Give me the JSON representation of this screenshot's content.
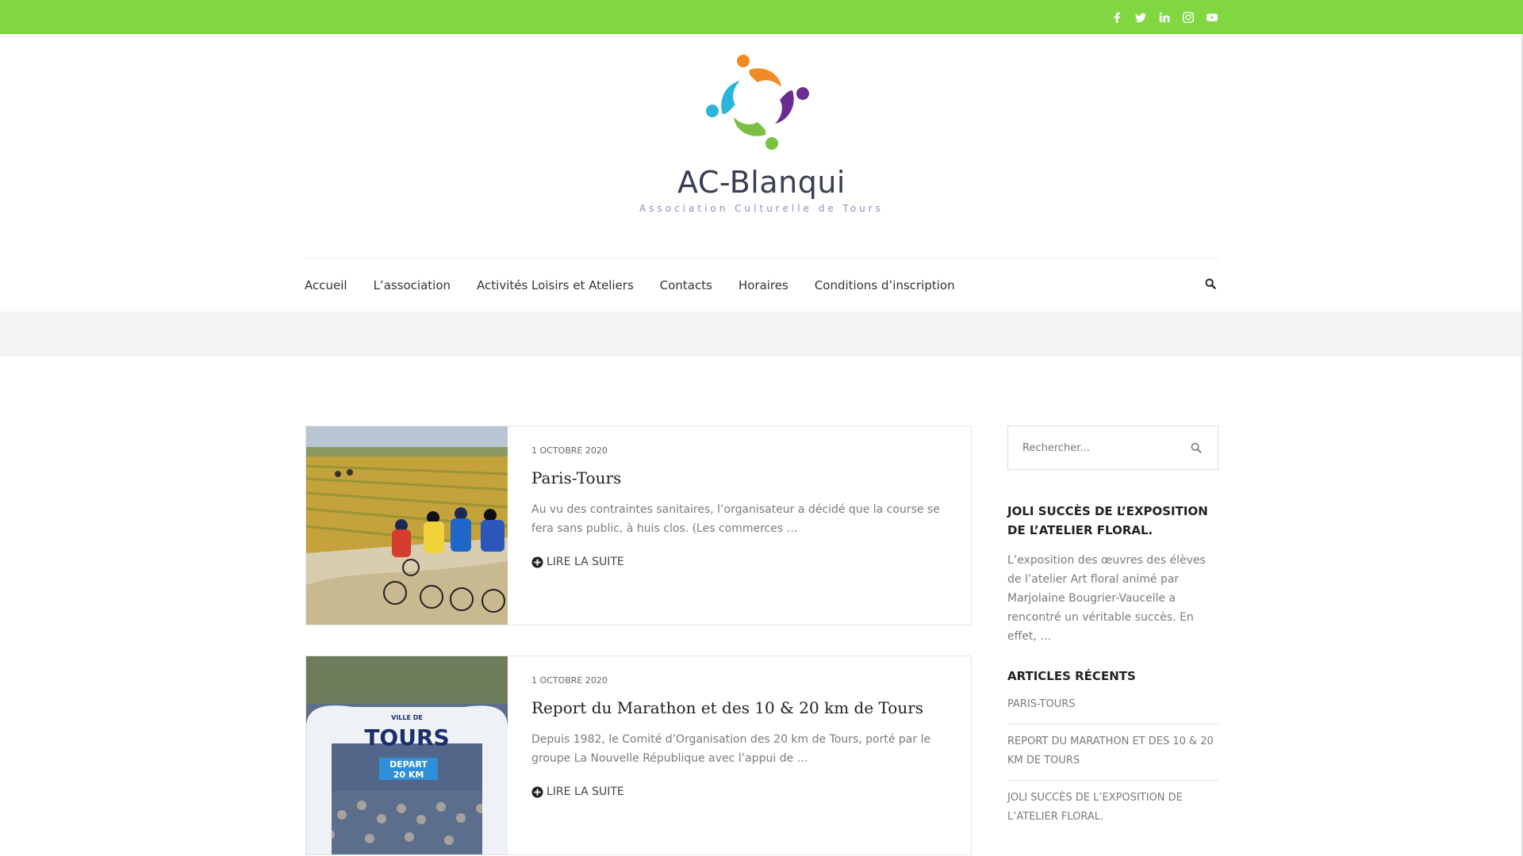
{
  "topbar": {
    "color": "#81d742",
    "social": [
      "facebook-icon",
      "twitter-icon",
      "linkedin-icon",
      "instagram-icon",
      "youtube-icon"
    ]
  },
  "site": {
    "title": "AC-Blanqui",
    "tagline": "Association Culturelle de Tours"
  },
  "nav": {
    "items": [
      "Accueil",
      "L’association",
      "Activités Loisirs et Ateliers",
      "Contacts",
      "Horaires",
      "Conditions d’inscription"
    ]
  },
  "posts": [
    {
      "date": "1 octobre 2020",
      "title": "Paris-Tours",
      "excerpt": "Au vu des contraintes sanitaires, l’organisateur a décidé que la course se fera sans public, à huis clos. (Les commerces …",
      "more": "Lire la suite",
      "image": "cyclists-in-vineyard"
    },
    {
      "date": "1 octobre 2020",
      "title": "Report du Marathon et des 10 & 20 km de Tours",
      "excerpt": "Depuis 1982, le Comité d’Organisation des 20 km de Tours, porté par le groupe La Nouvelle République avec l’appui de …",
      "more": "Lire la suite",
      "image": "marathon-start-arch",
      "arch_top": "VILLE DE",
      "arch_main": "TOURS",
      "arch_sub1": "DEPART",
      "arch_sub2": "20 KM"
    }
  ],
  "sidebar": {
    "search_placeholder": "Rechercher...",
    "widget1": {
      "title": "Joli succès de l’exposition de l’atelier floral.",
      "text": "L’exposition des œuvres des élèves de l’atelier Art floral animé par Marjolaine Bougrier-Vaucelle a rencontré un véritable succès. En effet, …"
    },
    "widget2": {
      "title": "Articles récents",
      "items": [
        "Paris-Tours",
        "Report du Marathon et des 10 & 20 km de Tours",
        "Joli succès de l’exposition de l’atelier floral."
      ]
    }
  }
}
